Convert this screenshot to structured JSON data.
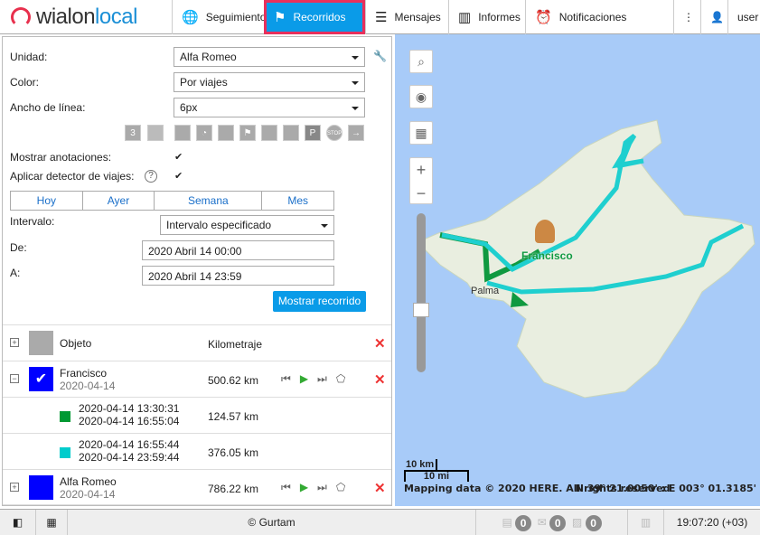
{
  "header": {
    "logo_a": "wialon",
    "logo_b": "local",
    "nav": [
      {
        "label": "Seguimiento",
        "icon": "globe-icon"
      },
      {
        "label": "Recorridos",
        "icon": "flag-icon"
      },
      {
        "label": "Mensajes",
        "icon": "messages-icon"
      },
      {
        "label": "Informes",
        "icon": "reports-icon"
      },
      {
        "label": "Notificaciones",
        "icon": "alarm-icon"
      }
    ],
    "more": "⋮",
    "user": "user"
  },
  "form": {
    "unit_label": "Unidad:",
    "unit_value": "Alfa Romeo",
    "color_label": "Color:",
    "color_value": "Por viajes",
    "width_label": "Ancho de línea:",
    "width_value": "6px",
    "annotations_label": "Mostrar anotaciones:",
    "trip_detector_label": "Aplicar detector de viajes:",
    "periods": [
      "Hoy",
      "Ayer",
      "Semana",
      "Mes"
    ],
    "interval_label": "Intervalo:",
    "interval_value": "Intervalo especificado",
    "from_label": "De:",
    "from_value": "2020 Abril 14 00:00",
    "to_label": "A:",
    "to_value": "2020 Abril 14 23:59",
    "show_button": "Mostrar recorrido"
  },
  "table": {
    "header": {
      "object": "Objeto",
      "mileage": "Kilometraje"
    },
    "rows": [
      {
        "name": "Francisco",
        "date": "2020-04-14",
        "mileage": "500.62 km",
        "color": "#0000ff"
      },
      {
        "name": "Alfa Romeo",
        "date": "2020-04-14",
        "mileage": "786.22 km",
        "color": "#0000ff"
      }
    ],
    "trips": [
      {
        "start": "2020-04-14 13:30:31",
        "end": "2020-04-14 16:55:04",
        "mileage": "124.57 km",
        "color": "#009933"
      },
      {
        "start": "2020-04-14 16:55:44",
        "end": "2020-04-14 23:59:44",
        "mileage": "376.05 km",
        "color": "#00cccc"
      }
    ]
  },
  "map": {
    "unit_label": "Francisco",
    "city": "Palma",
    "scale_km": "10 km",
    "scale_mi": "10 mi",
    "copyright": "Mapping data © 2020 HERE. All rights reserved",
    "coords": "N 39° 21.0050' : E 003° 01.3185'",
    "track_color": "#1fcfcf"
  },
  "footer": {
    "copyright": "© Gurtam",
    "counts": [
      "0",
      "0",
      "0"
    ],
    "time": "19:07:20 (+03)"
  }
}
